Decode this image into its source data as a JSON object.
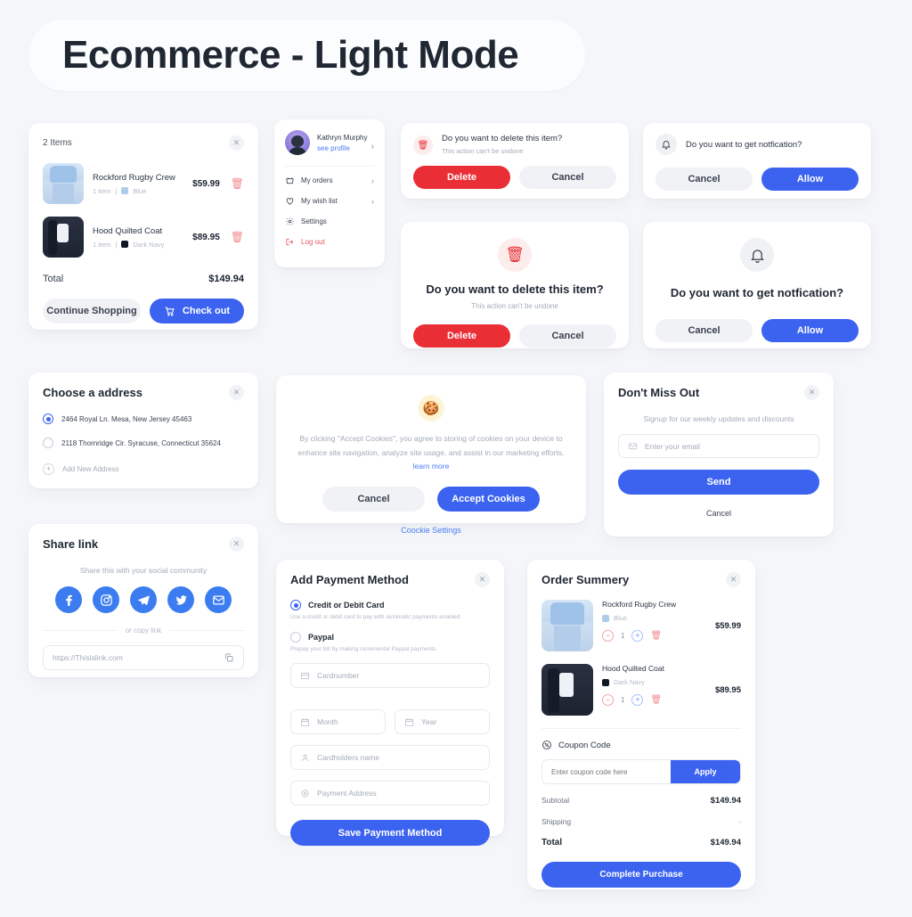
{
  "page": {
    "title": "Ecommerce - Light Mode"
  },
  "colors": {
    "background": "#f4f6f9",
    "card": "#ffffff",
    "accent_blue": "#3b63f0",
    "danger_red": "#ea2e35",
    "muted_grey": "#a3abb8",
    "social_blue": "#3b7df0"
  },
  "cart": {
    "items_count_label": "2 Items",
    "close_icon": "close-icon",
    "items": [
      {
        "name": "Rockford Rugby Crew",
        "qty_label": "1 item",
        "color_label": "Blue",
        "swatch": "#aecbea",
        "price": "$59.99",
        "delete_icon": "trash-icon"
      },
      {
        "name": "Hood Quilted Coat",
        "qty_label": "1 item",
        "color_label": "Dark Navy",
        "swatch": "#0f1723",
        "price": "$89.95",
        "delete_icon": "trash-icon"
      }
    ],
    "total_label": "Total",
    "total_value": "$149.94",
    "continue_label": "Continue Shopping",
    "checkout_label": "Check out",
    "checkout_icon": "cart-icon"
  },
  "profile": {
    "name": "Kathryn Murphy",
    "see_profile_label": "see profile",
    "chevron_icon": "chevron-right-icon",
    "menu": [
      {
        "label": "My orders",
        "icon": "basket-icon",
        "chevron": true
      },
      {
        "label": "My wish list",
        "icon": "heart-icon",
        "chevron": true
      },
      {
        "label": "Settings",
        "icon": "gear-icon",
        "chevron": false
      },
      {
        "label": "Log out",
        "icon": "logout-icon",
        "chevron": false
      }
    ]
  },
  "delete_banner": {
    "icon": "trash-icon",
    "question": "Do you want to delete this item?",
    "subtext": "This action can't be undone",
    "confirm_label": "Delete",
    "cancel_label": "Cancel"
  },
  "notify_banner": {
    "icon": "bell-icon",
    "question": "Do you want to get notfication?",
    "cancel_label": "Cancel",
    "allow_label": "Allow"
  },
  "delete_modal": {
    "icon": "trash-icon",
    "question": "Do you want to delete this item?",
    "subtext": "This action can't be undone",
    "confirm_label": "Delete",
    "cancel_label": "Cancel"
  },
  "notify_modal": {
    "icon": "bell-icon",
    "question": "Do you want to get notfication?",
    "cancel_label": "Cancel",
    "allow_label": "Allow"
  },
  "address": {
    "title": "Choose a address",
    "close_icon": "close-icon",
    "options": [
      {
        "label": "2464 Royal Ln. Mesa, New Jersey 45463",
        "selected": true
      },
      {
        "label": "2118 Thornridge Cir. Syracuse, Connecticut 35624",
        "selected": false
      }
    ],
    "add_label": "Add New Address",
    "add_icon": "plus-circle-icon"
  },
  "cookie": {
    "icon": "cookie-icon",
    "text": "By clicking \"Accept Cookies\", you agree to storing of cookies on your device to enhance site navigation, analyze site usage, and assist in our marketing efforts.",
    "learn_more_label": "learn more",
    "cancel_label": "Cancel",
    "accept_label": "Accept Cookies",
    "settings_label": "Coockie Settings"
  },
  "newsletter": {
    "title": "Don't Miss Out",
    "close_icon": "close-icon",
    "subtitle": "Signup for our weekly updates and discounts",
    "email_placeholder": "Enter your email",
    "email_icon": "mail-icon",
    "send_label": "Send",
    "cancel_label": "Cancel"
  },
  "share": {
    "title": "Share link",
    "close_icon": "close-icon",
    "subtitle": "Share this with your social community",
    "socials": [
      {
        "name": "facebook-icon"
      },
      {
        "name": "instagram-icon"
      },
      {
        "name": "telegram-icon"
      },
      {
        "name": "twitter-icon"
      },
      {
        "name": "email-icon"
      }
    ],
    "or_label": "or copy link",
    "link_value": "https://Thisislink.com",
    "copy_icon": "copy-icon"
  },
  "payment": {
    "title": "Add Payment Method",
    "close_icon": "close-icon",
    "methods": [
      {
        "label": "Credit or Debit Card",
        "desc": "Use a credit or debit card to pay with automatic payments enabled.",
        "selected": true
      },
      {
        "label": "Paypal",
        "desc": "Prepay your bill by making incremental Paypal payments.",
        "selected": false
      }
    ],
    "fields": {
      "cardnumber": "Cardnumber",
      "month": "Month",
      "year": "Year",
      "cardholder": "Cardholders name",
      "address": "Payment Address"
    },
    "icons": {
      "cardnumber": "card-icon",
      "month": "calendar-icon",
      "year": "calendar-icon",
      "cardholder": "user-icon",
      "address": "location-icon"
    },
    "save_label": "Save Payment Method"
  },
  "order": {
    "title": "Order Summery",
    "close_icon": "close-icon",
    "items": [
      {
        "name": "Rockford Rugby Crew",
        "color_label": "Blue",
        "swatch": "#aecbea",
        "qty": "1",
        "price": "$59.99"
      },
      {
        "name": "Hood Quilted Coat",
        "color_label": "Dark Navy",
        "swatch": "#0f1723",
        "qty": "1",
        "price": "$89.95"
      }
    ],
    "coupon_label": "Coupon Code",
    "coupon_icon": "discount-icon",
    "coupon_placeholder": "Enter coupon code here",
    "apply_label": "Apply",
    "totals": [
      {
        "label": "Subtotal",
        "value": "$149.94"
      },
      {
        "label": "Shipping",
        "value": "-"
      }
    ],
    "total_label": "Total",
    "total_value": "$149.94",
    "complete_label": "Complete Purchase"
  }
}
